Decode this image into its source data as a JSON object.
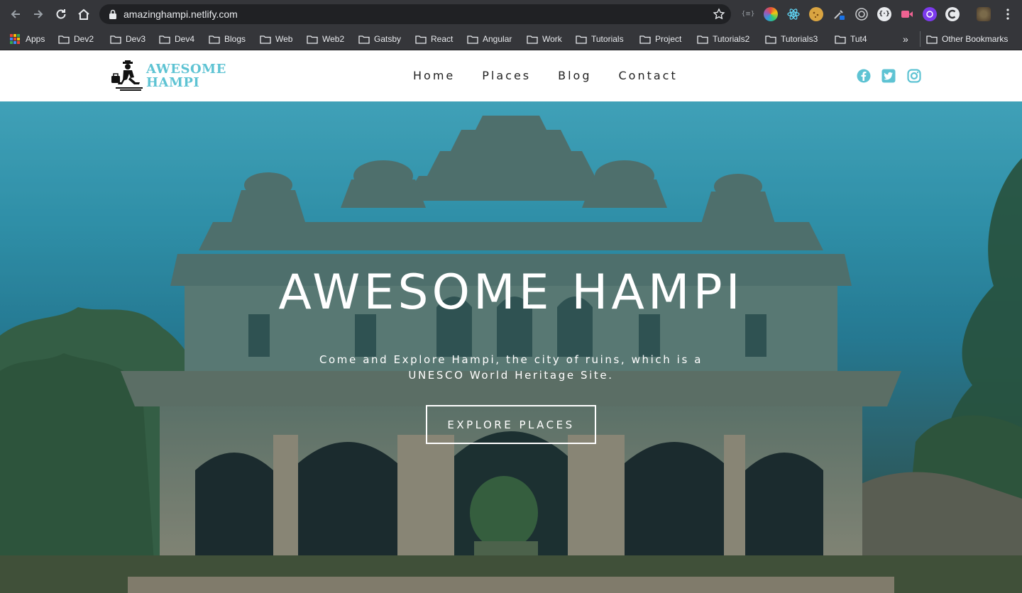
{
  "browser": {
    "url": "amazinghampi.netlify.com",
    "bookmarks": {
      "apps_label": "Apps",
      "folders": [
        "Dev2",
        "Dev3",
        "Dev4",
        "Blogs",
        "Web",
        "Web2",
        "Gatsby",
        "React",
        "Angular",
        "Work",
        "Tutorials",
        "Project",
        "Tutorials2",
        "Tutorials3",
        "Tut4"
      ],
      "overflow": "»",
      "other": "Other Bookmarks"
    },
    "extensions": [
      "json-viewer-icon",
      "color-picker-icon",
      "react-devtools-icon",
      "cookie-icon",
      "eyedropper-icon",
      "target-icon",
      "bracket-icon",
      "video-icon",
      "purple-circle-icon",
      "c-logo-icon",
      "profile-avatar-icon",
      "menu-kebab-icon"
    ]
  },
  "site": {
    "logo": {
      "line1": "AWESOME",
      "line2": "HAMPI"
    },
    "nav": [
      "Home",
      "Places",
      "Blog",
      "Contact"
    ],
    "social": [
      "facebook-icon",
      "twitter-icon",
      "instagram-icon"
    ],
    "accent_color": "#5ec3d3"
  },
  "hero": {
    "title": "AWESOME HAMPI",
    "subtitle": "Come and Explore Hampi, the city of ruins, which is a UNESCO World Heritage Site.",
    "button": "EXPLORE PLACES"
  }
}
